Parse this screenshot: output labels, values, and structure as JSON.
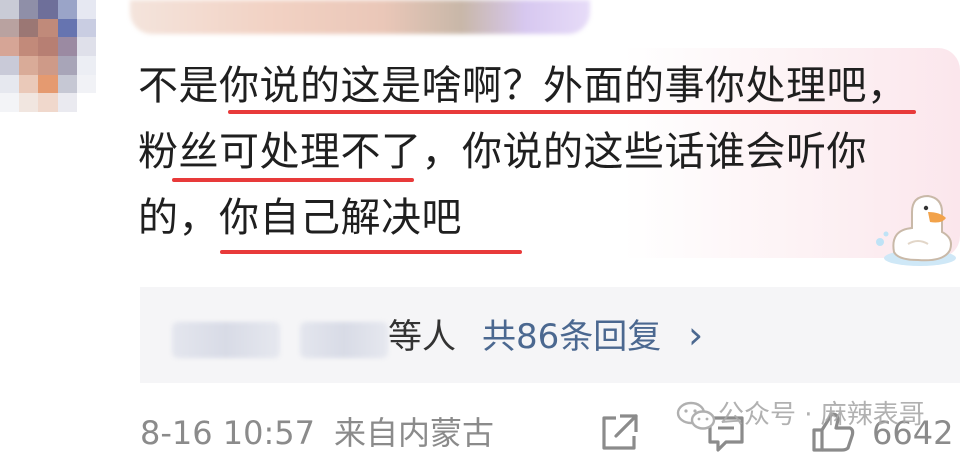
{
  "comment": {
    "lines": [
      "不是你说的这是啥啊？外面的事你处理吧，",
      "粉丝可处理不了，你说的这些话谁会听你",
      "的，你自己解决吧"
    ]
  },
  "replies": {
    "suffix": "等人",
    "count_label": "共86条回复",
    "chevron": "›"
  },
  "footer": {
    "time": "8-16 10:57",
    "location": "来自内蒙古",
    "like_count": "6642"
  },
  "watermark": {
    "text": "公众号 · 麻辣表哥"
  },
  "icons": {
    "share": "share-icon",
    "reply": "comment-icon",
    "like": "thumbs-up-icon",
    "watermark_logo": "wechat-icon",
    "decoration": "duck-icon"
  },
  "colors": {
    "underline": "#e83a3a",
    "link": "#4b6890",
    "footer_text": "#8b8b8b"
  }
}
